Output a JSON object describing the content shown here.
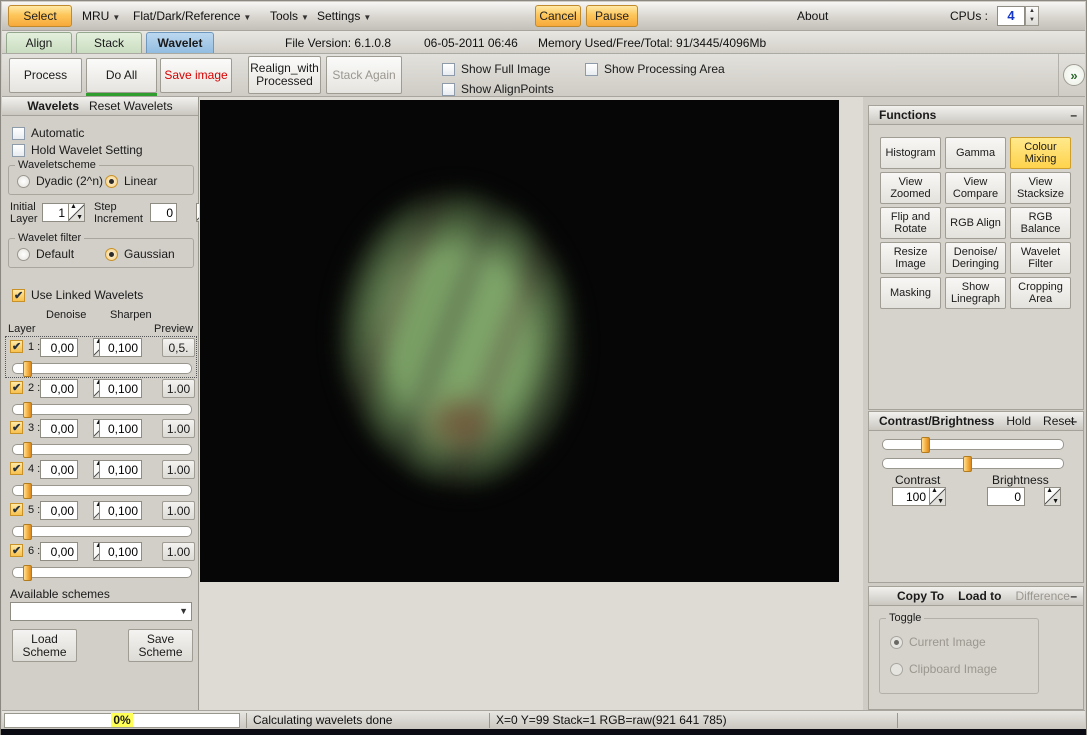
{
  "menubar": {
    "select": "Select",
    "mru": "MRU",
    "flat_dark_reference": "Flat/Dark/Reference",
    "tools": "Tools",
    "settings": "Settings",
    "cancel": "Cancel",
    "pause": "Pause",
    "about": "About",
    "cpus_label": "CPUs :",
    "cpus_value": "4"
  },
  "tabs": {
    "align": "Align",
    "stack": "Stack",
    "wavelet": "Wavelet",
    "file_version": "File Version: 6.1.0.8",
    "datetime": "06-05-2011 06:46",
    "memory": "Memory Used/Free/Total: 91/3445/4096Mb"
  },
  "toolbar": {
    "process": "Process",
    "do_all": "Do All",
    "save_image": "Save image",
    "realign": "Realign_with Processed",
    "stack_again": "Stack Again",
    "show_full_image": "Show Full Image",
    "show_alignpoints": "Show AlignPoints",
    "show_processing_area": "Show Processing Area",
    "expand": "»"
  },
  "wavelet_panel": {
    "title": "Wavelets",
    "reset": "Reset Wavelets",
    "automatic": "Automatic",
    "hold": "Hold Wavelet Setting",
    "scheme_group": "Waveletscheme",
    "dyadic": "Dyadic (2^n)",
    "linear": "Linear",
    "initial_layer_label": "Initial Layer",
    "initial_layer": "1",
    "step_increment_label": "Step Increment",
    "step_increment": "0",
    "filter_group": "Wavelet filter",
    "filter_default": "Default",
    "gaussian": "Gaussian",
    "use_linked": "Use Linked Wavelets",
    "col_denoise": "Denoise",
    "col_sharpen": "Sharpen",
    "col_layer": "Layer",
    "col_preview": "Preview",
    "layers": [
      {
        "num": "1 :",
        "denoise": "0,00",
        "sharpen": "0,100",
        "preview": "0,5."
      },
      {
        "num": "2 :",
        "denoise": "0,00",
        "sharpen": "0,100",
        "preview": "1.00"
      },
      {
        "num": "3 :",
        "denoise": "0,00",
        "sharpen": "0,100",
        "preview": "1.00"
      },
      {
        "num": "4 :",
        "denoise": "0,00",
        "sharpen": "0,100",
        "preview": "1.00"
      },
      {
        "num": "5 :",
        "denoise": "0,00",
        "sharpen": "0,100",
        "preview": "1.00"
      },
      {
        "num": "6 :",
        "denoise": "0,00",
        "sharpen": "0,100",
        "preview": "1.00"
      }
    ],
    "available_schemes": "Available schemes",
    "load_scheme": "Load Scheme",
    "save_scheme": "Save Scheme"
  },
  "functions_panel": {
    "title": "Functions",
    "buttons": [
      "Histogram",
      "Gamma",
      "Colour Mixing",
      "View Zoomed",
      "View Compare",
      "View Stacksize",
      "Flip and Rotate",
      "RGB Align",
      "RGB Balance",
      "Resize Image",
      "Denoise/ Deringing",
      "Wavelet Filter",
      "Masking",
      "Show Linegraph",
      "Cropping Area"
    ],
    "active_button": "Colour Mixing"
  },
  "contrast_panel": {
    "title": "Contrast/Brightness",
    "hold": "Hold",
    "reset": "Reset",
    "contrast_label": "Contrast",
    "contrast_value": "100",
    "brightness_label": "Brightness",
    "brightness_value": "0"
  },
  "copy_panel": {
    "copy_to": "Copy To",
    "load_to": "Load to",
    "difference": "Difference",
    "toggle": "Toggle",
    "current_image": "Current Image",
    "clipboard_image": "Clipboard Image"
  },
  "statusbar": {
    "progress": "0%",
    "message": "Calculating wavelets done",
    "coords": "X=0 Y=99 Stack=1 RGB=raw(921 641 785)"
  },
  "colors": {
    "accent_orange": "#f7a93a",
    "active_tab_blue": "#92bce0",
    "tab_green": "#c9ddc0",
    "save_image_red": "#d60000",
    "selected_yellow": "#ffd34d",
    "progress_highlight": "#ffff55",
    "jupiter_green": "#7aa065"
  }
}
